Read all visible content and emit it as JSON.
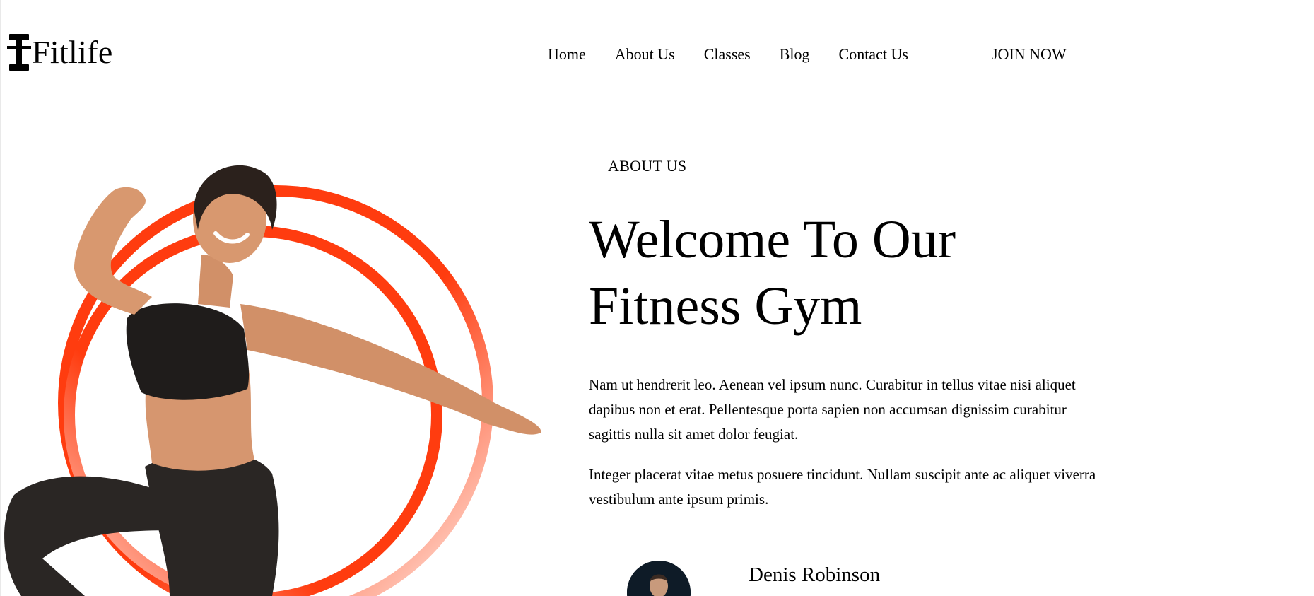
{
  "brand": {
    "name": "Fitlife",
    "logo_icon": "dumbbell-icon"
  },
  "nav": {
    "items": [
      {
        "label": "Home"
      },
      {
        "label": "About Us"
      },
      {
        "label": "Classes"
      },
      {
        "label": "Blog"
      },
      {
        "label": "Contact Us"
      }
    ],
    "cta_label": "JOIN NOW"
  },
  "about": {
    "eyebrow": "ABOUT US",
    "headline_line1": "Welcome To Our",
    "headline_line2": "Fitness Gym",
    "paragraph1": "Nam ut hendrerit leo. Aenean vel ipsum nunc. Curabitur in tellus vitae nisi aliquet dapibus non et erat. Pellentesque porta sapien non accumsan dignissim curabitur sagittis nulla sit amet dolor feugiat.",
    "paragraph2": "Integer placerat vitae metus posuere tincidunt. Nullam suscipit ante ac aliquet viverra vestibulum ante ipsum primis.",
    "author_name": "Denis Robinson"
  },
  "colors": {
    "accent": "#ff3c0f",
    "text": "#000000",
    "background": "#ffffff"
  }
}
